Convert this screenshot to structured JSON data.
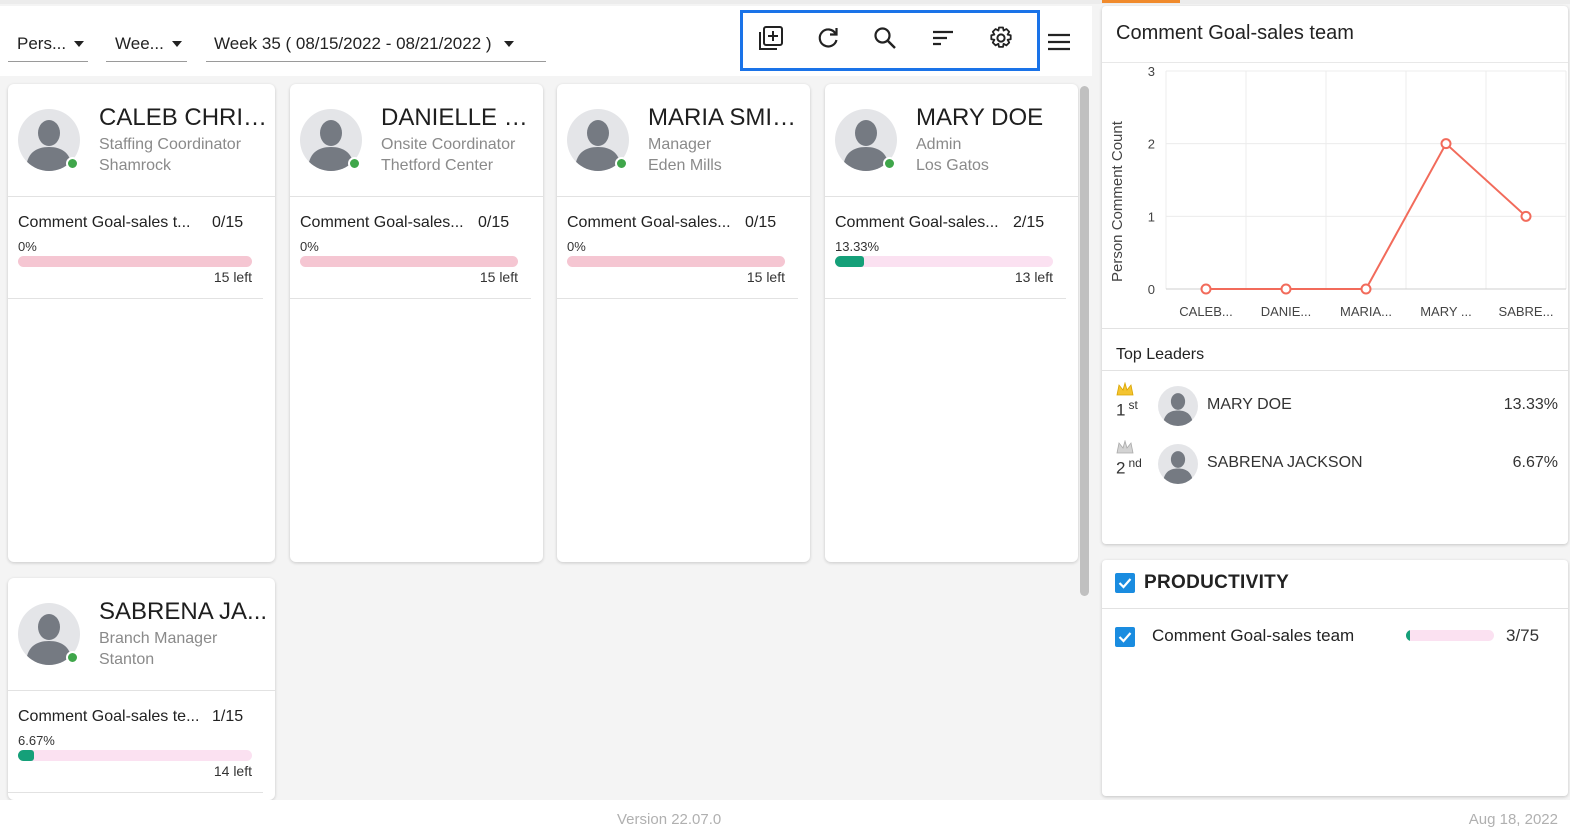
{
  "toolbar": {
    "filter_person": "Pers...",
    "filter_period": "Wee...",
    "filter_week": "Week 35 ( 08/15/2022 - 08/21/2022 )",
    "icons": [
      "add-box-icon",
      "refresh-icon",
      "search-icon",
      "sort-icon",
      "gear-icon",
      "menu-icon"
    ]
  },
  "cards": [
    {
      "name": "CALEB CHRIS...",
      "role": "Staffing Coordinator",
      "location": "Shamrock",
      "goal": "Comment Goal-sales t...",
      "count": "0/15",
      "percent": "0%",
      "progress": 0,
      "left": "15 left"
    },
    {
      "name": "DANIELLE JA...",
      "role": "Onsite Coordinator",
      "location": "Thetford Center",
      "goal": "Comment Goal-sales...",
      "count": "0/15",
      "percent": "0%",
      "progress": 0,
      "left": "15 left"
    },
    {
      "name": "MARIA SMITH",
      "role": "Manager",
      "location": "Eden Mills",
      "goal": "Comment Goal-sales...",
      "count": "0/15",
      "percent": "0%",
      "progress": 0,
      "left": "15 left"
    },
    {
      "name": "MARY DOE",
      "role": "Admin",
      "location": "Los Gatos",
      "goal": "Comment Goal-sales...",
      "count": "2/15",
      "percent": "13.33%",
      "progress": 13.33,
      "left": "13 left"
    },
    {
      "name": "SABRENA JA...",
      "role": "Branch Manager",
      "location": "Stanton",
      "goal": "Comment Goal-sales te...",
      "count": "1/15",
      "percent": "6.67%",
      "progress": 6.67,
      "left": "14 left"
    }
  ],
  "chart_panel": {
    "title": "Comment Goal-sales team",
    "top_leaders_title": "Top Leaders",
    "leaders": [
      {
        "rank": "1",
        "suffix": "st",
        "name": "MARY DOE",
        "percent": "13.33%"
      },
      {
        "rank": "2",
        "suffix": "nd",
        "name": "SABRENA JACKSON",
        "percent": "6.67%"
      }
    ]
  },
  "chart_data": {
    "type": "line",
    "title": "",
    "xlabel": "",
    "ylabel": "Person Comment Count",
    "categories": [
      "CALEB...",
      "DANIE...",
      "MARIA...",
      "MARY ...",
      "SABRE..."
    ],
    "values": [
      0,
      0,
      0,
      2,
      1
    ],
    "ylim": [
      0,
      3
    ],
    "yticks": [
      "0",
      "1",
      "2",
      "3"
    ],
    "grid": true,
    "color": "#f26b5b"
  },
  "productivity": {
    "title": "PRODUCTIVITY",
    "goal": "Comment Goal-sales team",
    "count": "3/75",
    "progress": 4
  },
  "footer": {
    "version": "Version 22.07.0",
    "date": "Aug 18, 2022"
  },
  "colors": {
    "accent": "#1a73e8",
    "online": "#3fa64a",
    "progress_fill": "#15a079",
    "bar_empty": "#f5c6d2",
    "bar_light": "#fbe1f1",
    "line": "#f26b5b"
  }
}
